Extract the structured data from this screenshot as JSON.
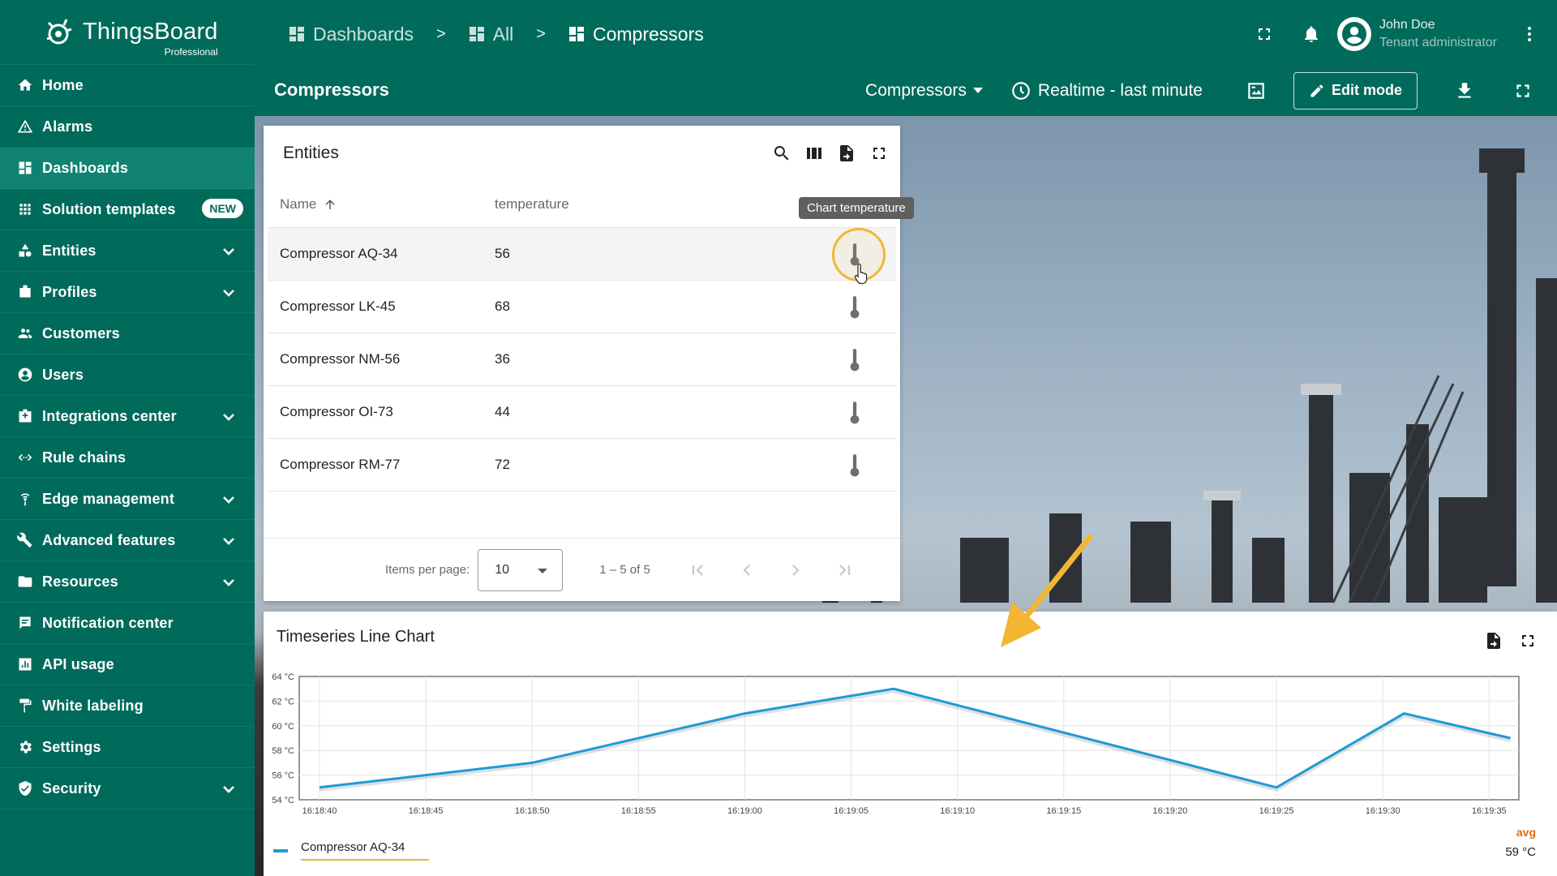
{
  "app": {
    "logo_name": "ThingsBoard",
    "logo_sub": "Professional"
  },
  "sidebar": {
    "items": [
      {
        "label": "Home",
        "icon": "home-icon"
      },
      {
        "label": "Alarms",
        "icon": "alarm-icon"
      },
      {
        "label": "Dashboards",
        "icon": "dashboard-icon",
        "active": true
      },
      {
        "label": "Solution templates",
        "icon": "apps-icon",
        "badge": "NEW"
      },
      {
        "label": "Entities",
        "icon": "entities-icon",
        "expandable": true
      },
      {
        "label": "Profiles",
        "icon": "profiles-icon",
        "expandable": true
      },
      {
        "label": "Customers",
        "icon": "customers-icon"
      },
      {
        "label": "Users",
        "icon": "users-icon"
      },
      {
        "label": "Integrations center",
        "icon": "integrations-icon",
        "expandable": true
      },
      {
        "label": "Rule chains",
        "icon": "rule-chains-icon"
      },
      {
        "label": "Edge management",
        "icon": "edge-icon",
        "expandable": true
      },
      {
        "label": "Advanced features",
        "icon": "tools-icon",
        "expandable": true
      },
      {
        "label": "Resources",
        "icon": "folder-icon",
        "expandable": true
      },
      {
        "label": "Notification center",
        "icon": "notification-icon"
      },
      {
        "label": "API usage",
        "icon": "api-usage-icon"
      },
      {
        "label": "White labeling",
        "icon": "paint-roller-icon"
      },
      {
        "label": "Settings",
        "icon": "gear-icon"
      },
      {
        "label": "Security",
        "icon": "shield-icon",
        "expandable": true
      }
    ]
  },
  "topbar": {
    "breadcrumbs": [
      "Dashboards",
      "All",
      "Compressors"
    ],
    "separator": ">",
    "user_name": "John Doe",
    "user_role": "Tenant administrator"
  },
  "dashbar": {
    "title": "Compressors",
    "state": "Compressors",
    "timewindow": "Realtime - last minute",
    "edit_label": "Edit mode"
  },
  "entities_widget": {
    "title": "Entities",
    "columns": [
      "Name",
      "temperature"
    ],
    "rows": [
      {
        "name": "Compressor AQ-34",
        "temperature": "56"
      },
      {
        "name": "Compressor LK-45",
        "temperature": "68"
      },
      {
        "name": "Compressor NM-56",
        "temperature": "36"
      },
      {
        "name": "Compressor OI-73",
        "temperature": "44"
      },
      {
        "name": "Compressor RM-77",
        "temperature": "72"
      }
    ],
    "tooltip": "Chart temperature",
    "paginator": {
      "items_per_page_label": "Items per page:",
      "items_per_page": "10",
      "range": "1 – 5 of 5"
    }
  },
  "chart_widget": {
    "title": "Timeseries Line Chart",
    "avg_header": "avg",
    "avg_value": "59 °C"
  },
  "colors": {
    "primary": "#006b5b",
    "active": "#0f8272",
    "series": "#1e9ad6",
    "highlight": "#f2b632",
    "avg": "#e36a00"
  },
  "chart_data": {
    "type": "line",
    "x": [
      "16:18:40",
      "16:18:45",
      "16:18:50",
      "16:18:55",
      "16:19:00",
      "16:19:05",
      "16:19:10",
      "16:19:15",
      "16:19:20",
      "16:19:25",
      "16:19:30",
      "16:19:35"
    ],
    "series": [
      {
        "name": "Compressor AQ-34",
        "points": [
          {
            "t": "16:18:40",
            "v": 55
          },
          {
            "t": "16:18:50",
            "v": 57
          },
          {
            "t": "16:19:00",
            "v": 61
          },
          {
            "t": "16:19:07",
            "v": 63
          },
          {
            "t": "16:19:25",
            "v": 55
          },
          {
            "t": "16:19:31",
            "v": 61
          },
          {
            "t": "16:19:36",
            "v": 59
          }
        ]
      }
    ],
    "ylim": [
      54,
      64
    ],
    "yticks": [
      "54 °C",
      "56 °C",
      "58 °C",
      "60 °C",
      "62 °C",
      "64 °C"
    ],
    "grid": true,
    "legend": "bottom-left"
  }
}
